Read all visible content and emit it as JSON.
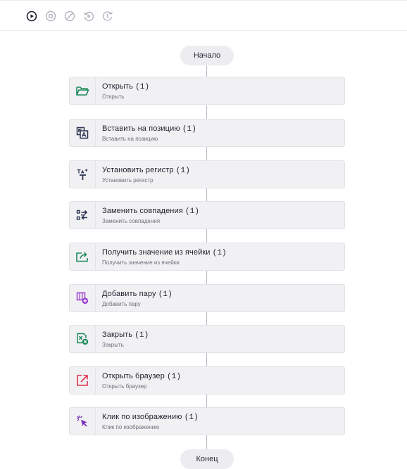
{
  "toolbar": {
    "buttons": [
      {
        "name": "run",
        "icon": "play-circle-icon"
      },
      {
        "name": "stop",
        "icon": "stop-circle-icon"
      },
      {
        "name": "disable",
        "icon": "block-icon"
      },
      {
        "name": "step",
        "icon": "step-into-icon"
      },
      {
        "name": "restart",
        "icon": "restart-one-icon"
      }
    ]
  },
  "flow": {
    "start_label": "Начало",
    "end_label": "Конец",
    "steps": [
      {
        "title": "Открыть",
        "count": "(1)",
        "subtitle": "Открыть",
        "icon": "folder-open-icon",
        "color": "#1f8a5b"
      },
      {
        "title": "Вставить на позицию",
        "count": "(1)",
        "subtitle": "Вставить на позицию",
        "icon": "insert-image-icon",
        "color": "#2a3350"
      },
      {
        "title": "Установить регистр",
        "count": "(1)",
        "subtitle": "Установить регистр",
        "icon": "text-case-icon",
        "color": "#2a3350"
      },
      {
        "title": "Заменить совпадения",
        "count": "(1)",
        "subtitle": "Заменить совпадения",
        "icon": "find-replace-icon",
        "color": "#2a3350"
      },
      {
        "title": "Получить значение из ячейки",
        "count": "(1)",
        "subtitle": "Получить значение из ячейки",
        "icon": "export-cell-icon",
        "color": "#1f8a5b"
      },
      {
        "title": "Добавить пару",
        "count": "(1)",
        "subtitle": "Добавить пару",
        "icon": "add-pair-icon",
        "color": "#9b3fd1"
      },
      {
        "title": "Закрыть",
        "count": "(1)",
        "subtitle": "Закрыть",
        "icon": "excel-close-icon",
        "color": "#1f8a5b"
      },
      {
        "title": "Открыть браузер",
        "count": "(1)",
        "subtitle": "Открыть браузер",
        "icon": "open-external-icon",
        "color": "#e0314f"
      },
      {
        "title": "Клик по изображению",
        "count": "(1)",
        "subtitle": "Клик по изображению",
        "icon": "cursor-click-icon",
        "color": "#7b2fc0"
      }
    ]
  }
}
